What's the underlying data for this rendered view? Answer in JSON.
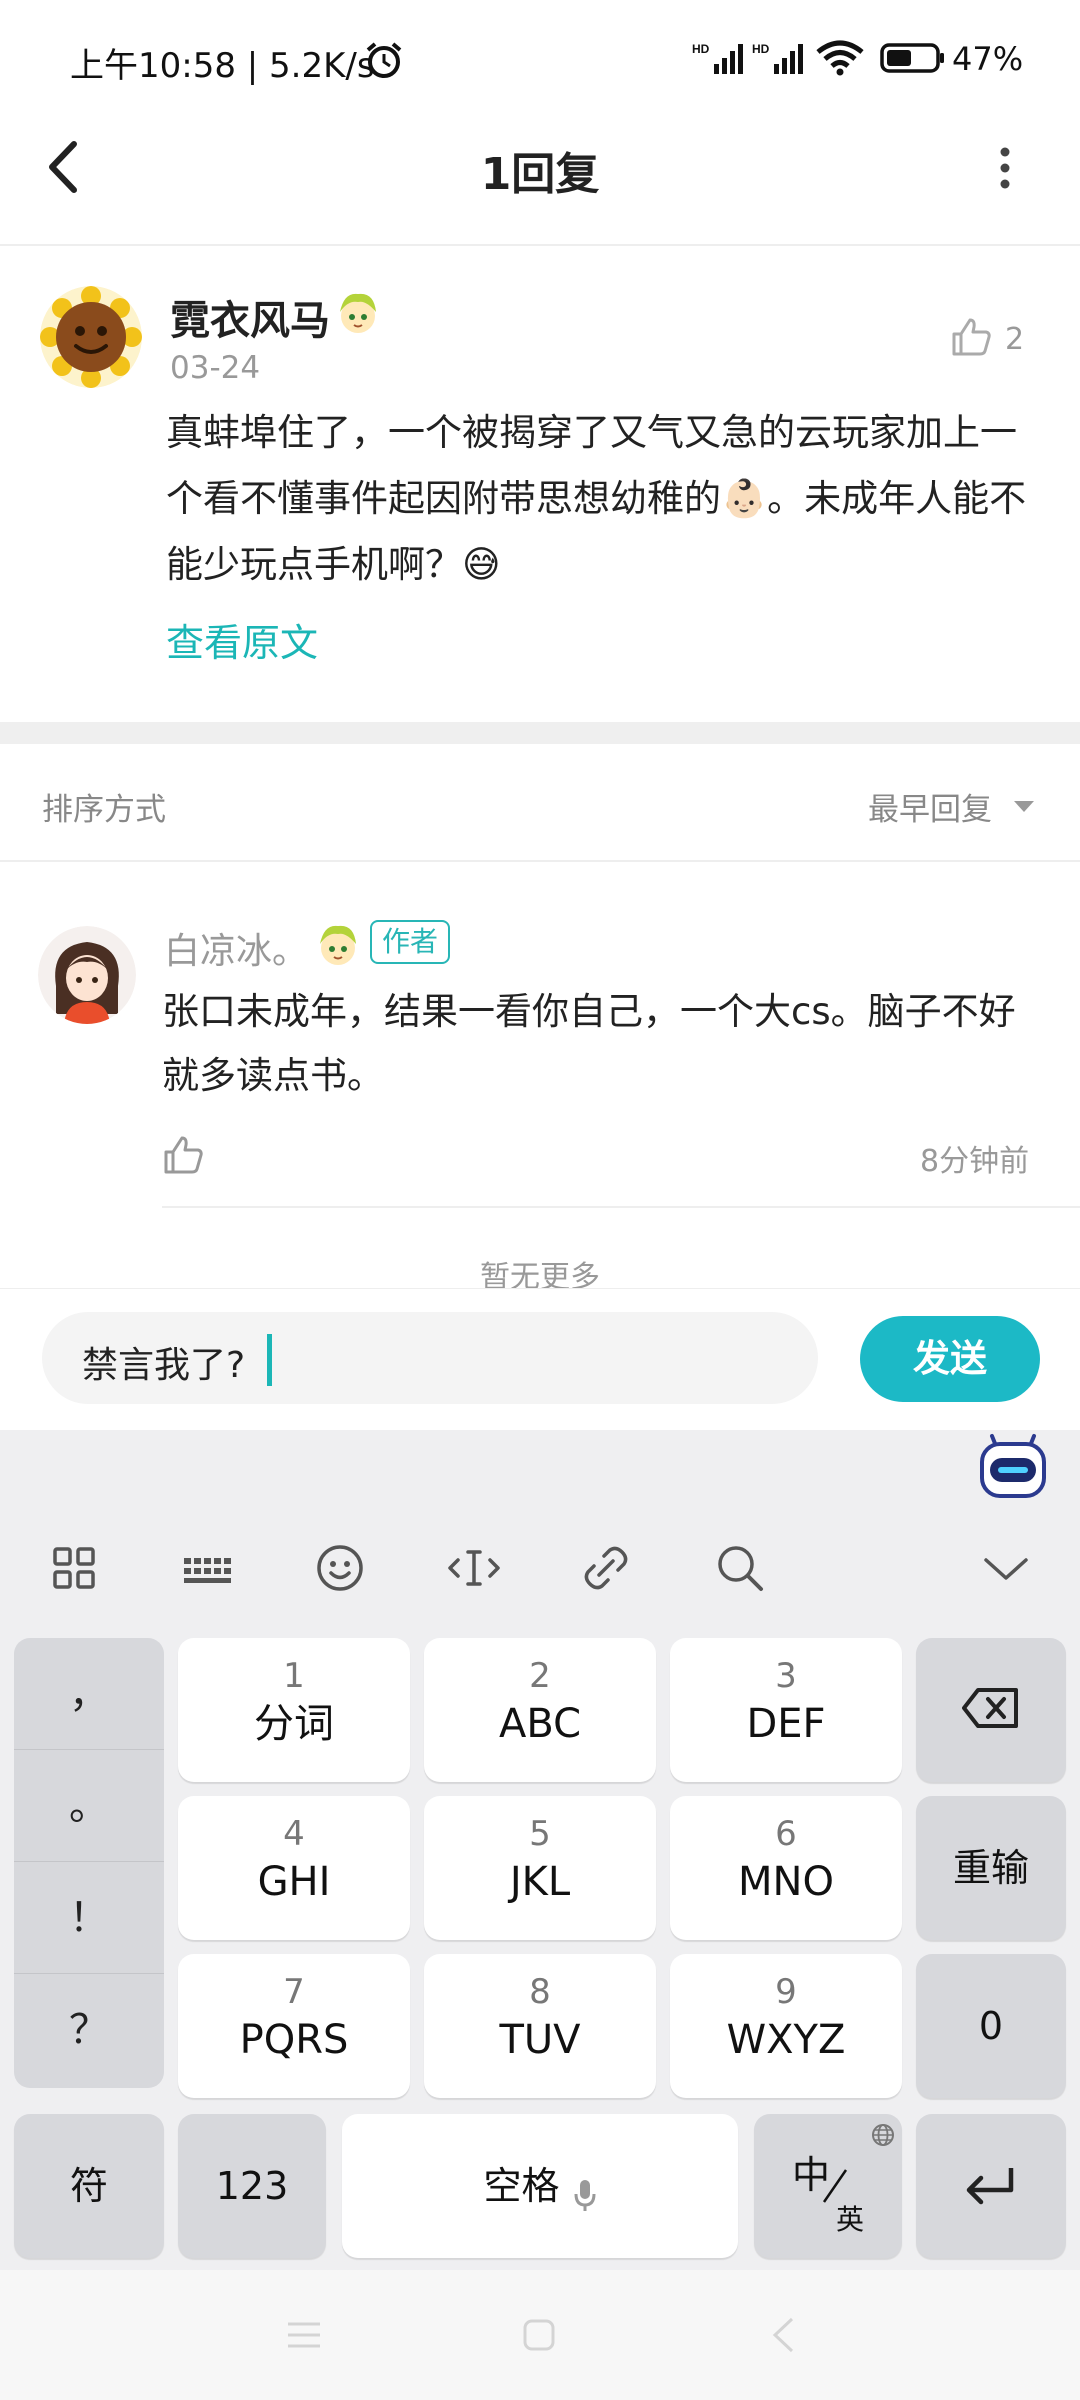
{
  "status_bar": {
    "time_speed": "上午10:58 | 5.2K/s",
    "battery_percent": "47%",
    "icons": [
      "alarm-icon",
      "hd-signal-icon",
      "hd-signal-icon",
      "wifi-icon",
      "battery-icon"
    ]
  },
  "header": {
    "title": "1回复",
    "back_icon": "back-arrow-icon",
    "more_icon": "more-vertical-icon"
  },
  "post": {
    "author": "霓衣风马",
    "date": "03-24",
    "likes": "2",
    "content": "真蚌埠住了，一个被揭穿了又气又急的云玩家加上一个看不懂事件起因附带思想幼稚的👶🏻。未成年人能不能少玩点手机啊？😅",
    "view_original": "查看原文"
  },
  "sort": {
    "label": "排序方式",
    "value": "最早回复"
  },
  "reply": {
    "author": "白凉冰。",
    "badge": "作者",
    "content": "张口未成年，结果一看你自己，一个大cs。脑子不好就多读点书。",
    "time": "8分钟前"
  },
  "footer_note": "暂无更多",
  "composer": {
    "input_value": "禁言我了?",
    "send_label": "发送"
  },
  "keyboard": {
    "toolbar_icons": [
      "grid-icon",
      "keyboard-icon",
      "emoji-icon",
      "cursor-icon",
      "link-icon",
      "search-icon",
      "collapse-icon"
    ],
    "punctuation": [
      "，",
      "。",
      "！",
      "？"
    ],
    "keys": [
      {
        "num": "1",
        "letters": "分词"
      },
      {
        "num": "2",
        "letters": "ABC"
      },
      {
        "num": "3",
        "letters": "DEF"
      },
      {
        "num": "4",
        "letters": "GHI"
      },
      {
        "num": "5",
        "letters": "JKL"
      },
      {
        "num": "6",
        "letters": "MNO"
      },
      {
        "num": "7",
        "letters": "PQRS"
      },
      {
        "num": "8",
        "letters": "TUV"
      },
      {
        "num": "9",
        "letters": "WXYZ"
      }
    ],
    "reinput": "重输",
    "zero": "0",
    "symbols": "符",
    "numbers": "123",
    "space": "空格",
    "lang_cn": "中",
    "lang_en": "英"
  },
  "colors": {
    "accent": "#1bb6b6",
    "send_button": "#1cb9c6",
    "keyboard_bg": "#efeff1"
  }
}
